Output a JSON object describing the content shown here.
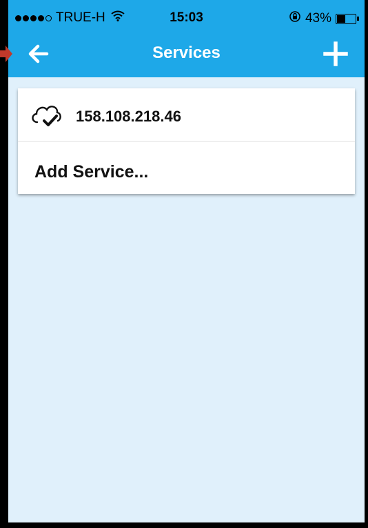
{
  "status_bar": {
    "carrier": "TRUE-H",
    "time": "15:03",
    "battery_percent": "43%",
    "battery_level": 0.43
  },
  "nav": {
    "title": "Services",
    "back_icon": "arrow-left-icon",
    "add_icon": "plus-icon"
  },
  "services": {
    "items": [
      {
        "label": "158.108.218.46",
        "icon": "cloud-check-icon"
      }
    ],
    "add_label": "Add Service..."
  },
  "colors": {
    "nav_bar": "#1ea8e8",
    "background": "#e0f0fb",
    "annotation_arrow": "#c0392b"
  }
}
